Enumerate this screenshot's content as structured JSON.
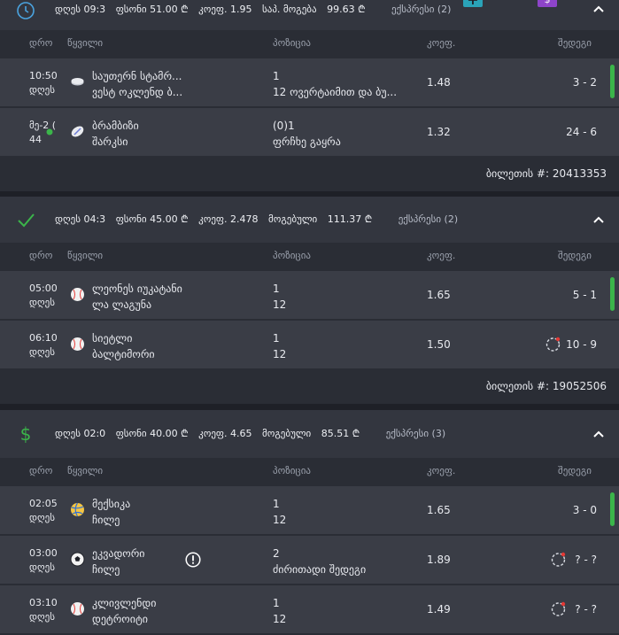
{
  "colors": {
    "win": "#3bb54a",
    "pending_dot": "#e53935",
    "bg": "#1e2027",
    "panel": "#2a2d35",
    "row": "#3a3d46",
    "add_button": "#2aa3b8",
    "cash_button": "#8e44c9"
  },
  "columns": {
    "time": "დრო",
    "event": "წყვილი",
    "position": "პოზიცია",
    "odd": "კოეფ.",
    "result": "შედეგი"
  },
  "tickets": [
    {
      "state_icon": "clock-icon",
      "header": {
        "date": "დღეს 09:3",
        "stake": "ფსონი  51.00 ₾",
        "odds": "კოეფ.  1.95",
        "matches": "საპ. მოგება",
        "payout": "99.63 ₾",
        "express": "ექსპრესი (2)"
      },
      "buttons": {
        "add": "+",
        "cash": "$"
      },
      "rows": [
        {
          "time1": "10:50",
          "time2": "დღეს",
          "sport_icon": "hockey-icon",
          "team1": "საუთერნ სტამრ...",
          "team2": "ვესტ ოკლენდ ბ...",
          "pos1": "1",
          "pos2": "12 ოვერტაიმით და ბუ...",
          "odd": "1.48",
          "score": "3 - 2",
          "status": "win"
        },
        {
          "time1": "მე-2 (",
          "time2": "44",
          "sport_icon": "rugby-icon",
          "team1": "ბრამბიზი",
          "team2": "შარკსი",
          "pos1": "(0)1",
          "pos2": "ფრჩხე გაყრა",
          "odd": "1.32",
          "score": "24 - 6",
          "status": "live"
        }
      ],
      "ticket_no": "ბილეთის #: 20413353"
    },
    {
      "state_icon": "check-icon",
      "header": {
        "date": "დღეს 04:3",
        "stake": "ფსონი  45.00 ₾",
        "odds": "კოეფ.  2.478",
        "matches": "მოგებული",
        "payout": "111.37 ₾",
        "express": "ექსპრესი (2)"
      },
      "rows": [
        {
          "time1": "05:00",
          "time2": "დღეს",
          "sport_icon": "baseball-icon",
          "team1": "ლეონეს იუკატანი",
          "team2": "ლა ლაგუნა",
          "pos1": "1",
          "pos2": "12",
          "odd": "1.65",
          "score": "5 - 1",
          "status": "win"
        },
        {
          "time1": "06:10",
          "time2": "დღეს",
          "sport_icon": "baseball-icon",
          "team1": "სიეტლი",
          "team2": "ბალტიმორი",
          "pos1": "1",
          "pos2": "12",
          "odd": "1.50",
          "score": "10 - 9",
          "status": "pending"
        }
      ],
      "ticket_no": "ბილეთის #: 19052506"
    },
    {
      "state_icon": "dollar-icon",
      "header": {
        "date": "დღეს 02:0",
        "stake": "ფსონი  40.00 ₾",
        "odds": "კოეფ.  4.65",
        "matches": "მოგებული",
        "payout": "85.51 ₾",
        "express": "ექსპრესი (3)"
      },
      "rows": [
        {
          "time1": "02:05",
          "time2": "დღეს",
          "sport_icon": "volleyball-icon",
          "team1": "მექსიკა",
          "team2": "ჩილე",
          "pos1": "1",
          "pos2": "12",
          "odd": "1.65",
          "score": "3 - 0",
          "status": "win"
        },
        {
          "time1": "03:00",
          "time2": "დღეს",
          "sport_icon": "soccer-icon",
          "team1": "ეკვადორი",
          "team2": "ჩილე",
          "pos1": "2",
          "pos2": "ძირითადი შედეგი",
          "odd": "1.89",
          "score": "? - ?",
          "status": "pending",
          "alert": true
        },
        {
          "time1": "03:10",
          "time2": "დღეს",
          "sport_icon": "baseball-icon",
          "team1": "კლივლენდი",
          "team2": "დეტროიტი",
          "pos1": "1",
          "pos2": "12",
          "odd": "1.49",
          "score": "? - ?",
          "status": "pending"
        }
      ]
    }
  ]
}
